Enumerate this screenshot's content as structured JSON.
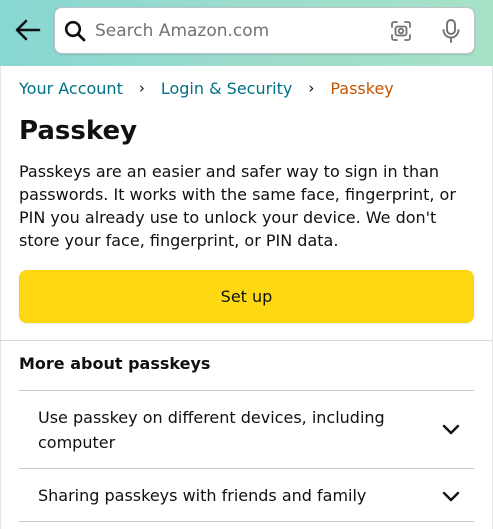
{
  "header": {
    "back_icon": "arrow-left-icon",
    "search": {
      "placeholder": "Search Amazon.com",
      "value": "",
      "search_icon": "magnifier-icon",
      "camera_icon": "camera-lens-icon",
      "mic_icon": "microphone-icon"
    },
    "gradient_colors": [
      "#87d7d2",
      "#a7e2c7"
    ]
  },
  "breadcrumb": {
    "items": [
      "Your Account",
      "Login & Security"
    ],
    "separator": "›",
    "current": "Passkey"
  },
  "page": {
    "title": "Passkey",
    "description": "Passkeys are an easier and safer way to sign in than passwords. It works with the same face, fingerprint, or PIN you already use to unlock your device. We don't store your face, fingerprint, or PIN data.",
    "setup_button_label": "Set up"
  },
  "more_section": {
    "heading": "More about passkeys",
    "items": [
      {
        "label": "Use passkey on different devices, including computer",
        "expanded": false
      },
      {
        "label": "Sharing passkeys with friends and family",
        "expanded": false
      }
    ]
  },
  "colors": {
    "link": "#007185",
    "breadcrumb_current": "#c45500",
    "button_primary": "#ffd814",
    "text": "#0f1111"
  }
}
